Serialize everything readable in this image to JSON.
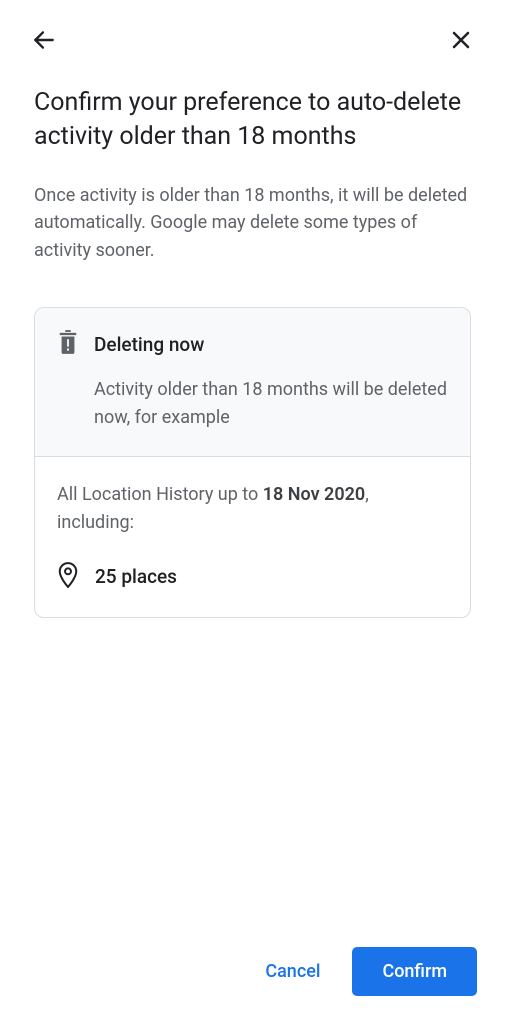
{
  "header": {
    "title": "Confirm your preference to auto-delete activity older than 18 months",
    "description": "Once activity is older than 18 months, it will be deleted automatically. Google may delete some types of activity sooner."
  },
  "card": {
    "title": "Deleting now",
    "subtitle": "Activity older than 18 months will be deleted now, for example",
    "history_prefix": "All Location History up to ",
    "history_date": "18 Nov 2020",
    "history_suffix": ", including:",
    "places_count": "25 places"
  },
  "footer": {
    "cancel_label": "Cancel",
    "confirm_label": "Confirm"
  }
}
